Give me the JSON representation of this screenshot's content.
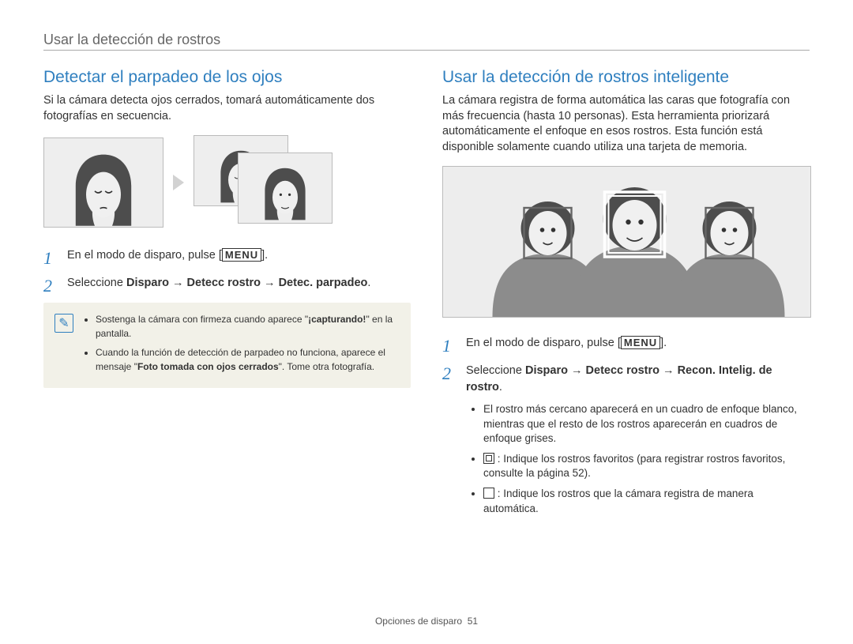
{
  "header": {
    "text": "Usar la detección de rostros"
  },
  "left": {
    "title": "Detectar el parpadeo de los ojos",
    "intro": "Si la cámara detecta ojos cerrados, tomará automáticamente dos fotografías en secuencia.",
    "step1_pre": "En el modo de disparo, pulse [",
    "step1_menu": "MENU",
    "step1_post": "].",
    "step2_pre": "Seleccione ",
    "step2_bold1": "Disparo",
    "step2_arrow": " → ",
    "step2_bold2": "Detecc rostro",
    "step2_bold3": "Detec. parpadeo",
    "step2_period": ".",
    "note1_pre": "Sostenga la cámara con firmeza cuando aparece \"",
    "note1_bold": "¡capturando!",
    "note1_post": "\" en la pantalla.",
    "note2_pre": "Cuando la función de detección de parpadeo no funciona, aparece el mensaje \"",
    "note2_bold": "Foto tomada con ojos cerrados",
    "note2_post": "\". Tome otra fotografía."
  },
  "right": {
    "title": "Usar la detección de rostros inteligente",
    "intro": "La cámara registra de forma automática las caras que fotografía con más frecuencia (hasta 10 personas). Esta herramienta priorizará automáticamente el enfoque en esos rostros. Esta función está disponible solamente cuando utiliza una tarjeta de memoria.",
    "step1_pre": "En el modo de disparo, pulse [",
    "step1_menu": "MENU",
    "step1_post": "].",
    "step2_pre": "Seleccione ",
    "step2_bold1": "Disparo",
    "step2_arrow": " → ",
    "step2_bold2": "Detecc rostro",
    "step2_bold3": "Recon. Intelig. de rostro",
    "step2_period": ".",
    "sub1": "El rostro más cercano aparecerá en un cuadro de enfoque blanco, mientras que el resto de los rostros aparecerán en cuadros de enfoque grises.",
    "sub2": " : Indique los rostros favoritos (para registrar rostros favoritos, consulte la página 52).",
    "sub3": " : Indique los rostros que la cámara registra de manera automática."
  },
  "footer": {
    "section": "Opciones de disparo",
    "page": "51"
  }
}
